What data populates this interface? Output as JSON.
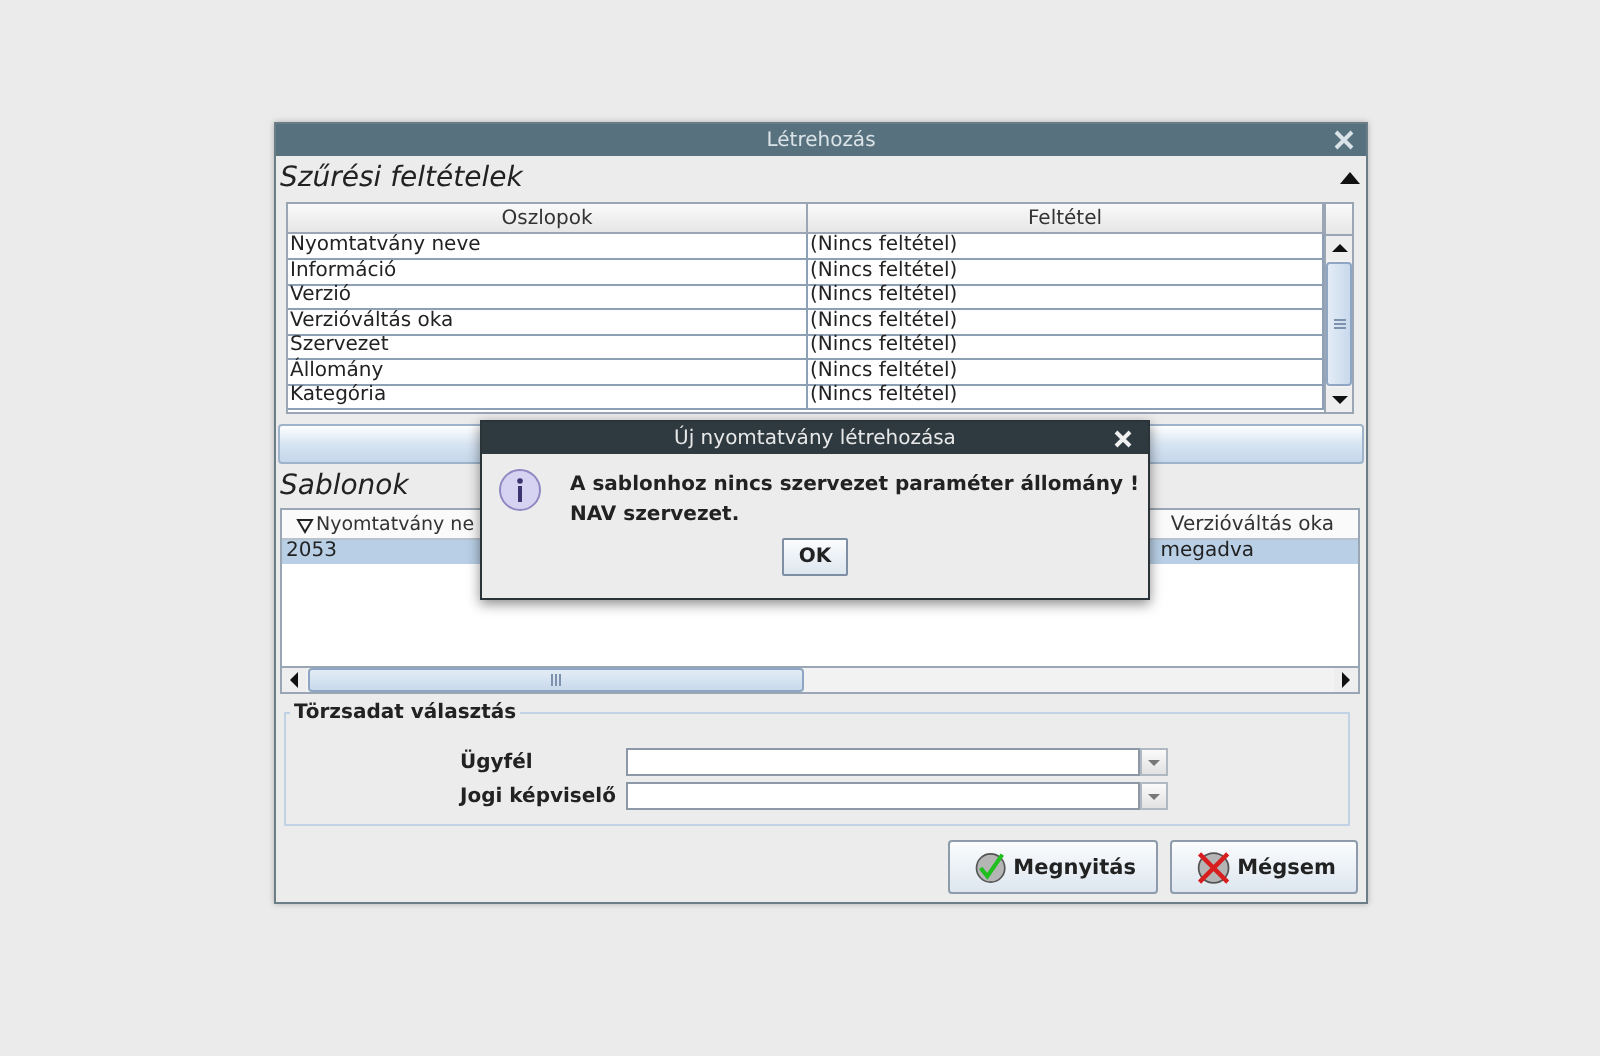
{
  "window": {
    "title": "Létrehozás"
  },
  "filter_section": {
    "title": "Szűrési feltételek",
    "expanded": true,
    "table": {
      "columns": [
        "Oszlopok",
        "Feltétel"
      ],
      "rows": [
        [
          "Nyomtatvány neve",
          "(Nincs feltétel)"
        ],
        [
          "Információ",
          "(Nincs feltétel)"
        ],
        [
          "Verzió",
          "(Nincs feltétel)"
        ],
        [
          "Verzióváltás oka",
          "(Nincs feltétel)"
        ],
        [
          "Szervezet",
          "(Nincs feltétel)"
        ],
        [
          "Állomány",
          "(Nincs feltétel)"
        ],
        [
          "Kategória",
          "(Nincs feltétel)"
        ]
      ]
    }
  },
  "templates_section": {
    "title": "Sablonok",
    "table": {
      "columns": [
        {
          "label": "Nyomtatvány ne",
          "sorted": true
        },
        {
          "label": "Verzióváltás oka",
          "sorted": false
        }
      ],
      "rows": [
        {
          "cells": [
            "2053",
            "megadva"
          ],
          "selected": true
        }
      ]
    }
  },
  "master_data": {
    "title": "Törzsadat választás",
    "fields": [
      {
        "label": "Ügyfél"
      },
      {
        "label": "Jogi képviselő"
      }
    ]
  },
  "buttons": [
    {
      "label": "Megnyitás",
      "kind": "ok"
    },
    {
      "label": "Mégsem",
      "kind": "cancel"
    }
  ],
  "dialog": {
    "title": "Új nyomtatvány létrehozása",
    "message": "A sablonhoz nincs szervezet paraméter állomány !\nNAV szervezet.",
    "buttons": [
      "OK"
    ]
  }
}
